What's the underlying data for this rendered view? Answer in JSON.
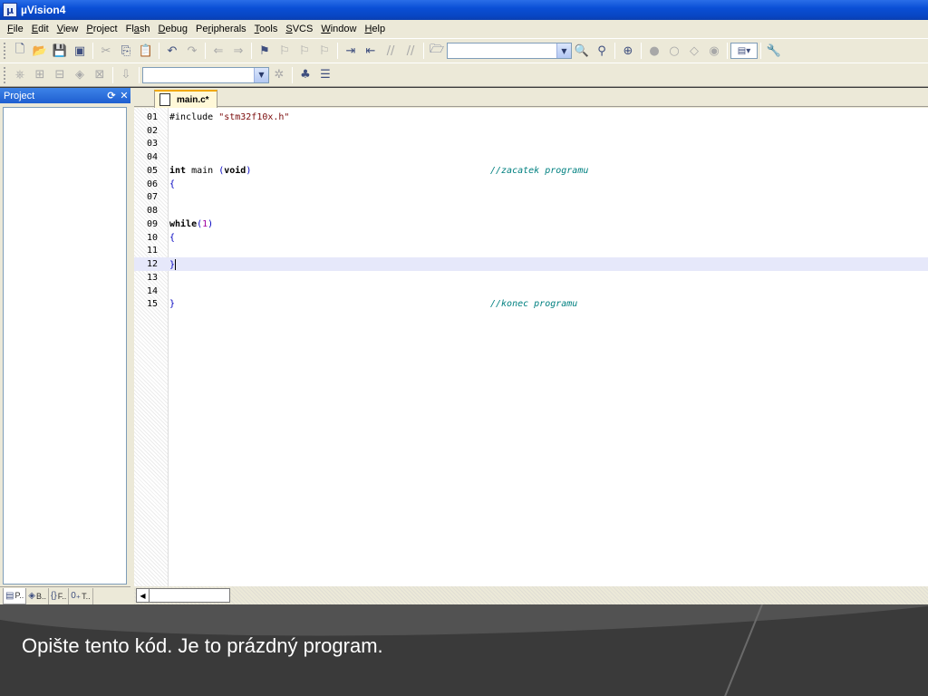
{
  "window": {
    "title": "µVision4"
  },
  "menu": [
    {
      "pre": "",
      "acc": "F",
      "post": "ile"
    },
    {
      "pre": "",
      "acc": "E",
      "post": "dit"
    },
    {
      "pre": "",
      "acc": "V",
      "post": "iew"
    },
    {
      "pre": "",
      "acc": "P",
      "post": "roject"
    },
    {
      "pre": "Fl",
      "acc": "a",
      "post": "sh"
    },
    {
      "pre": "",
      "acc": "D",
      "post": "ebug"
    },
    {
      "pre": "Pe",
      "acc": "r",
      "post": "ipherals"
    },
    {
      "pre": "",
      "acc": "T",
      "post": "ools"
    },
    {
      "pre": "",
      "acc": "S",
      "post": "VCS"
    },
    {
      "pre": "",
      "acc": "W",
      "post": "indow"
    },
    {
      "pre": "",
      "acc": "H",
      "post": "elp"
    }
  ],
  "project_panel": {
    "title": "Project",
    "tabs": [
      {
        "icon": "▤",
        "label": "P..",
        "icon_name": "project-tab-icon"
      },
      {
        "icon": "◈",
        "label": "B..",
        "icon_name": "books-tab-icon"
      },
      {
        "icon": "{}",
        "label": "F..",
        "icon_name": "functions-tab-icon"
      },
      {
        "icon": "0₊",
        "label": "T..",
        "icon_name": "templates-tab-icon"
      }
    ]
  },
  "editor": {
    "active_tab": "main.c*",
    "current_line": 12,
    "lines": [
      {
        "num": "01",
        "html": "#include <span class=\"str\">\"stm32f10x.h\"</span>",
        "comment": ""
      },
      {
        "num": "02",
        "html": "",
        "comment": ""
      },
      {
        "num": "03",
        "html": "",
        "comment": ""
      },
      {
        "num": "04",
        "html": "",
        "comment": ""
      },
      {
        "num": "05",
        "html": "<span class=\"kw\">int</span> main <span class=\"brace\">(</span><span class=\"kw\">void</span><span class=\"brace\">)</span>",
        "comment": "//zacatek programu"
      },
      {
        "num": "06",
        "html": "<span class=\"brace\">{</span>",
        "comment": ""
      },
      {
        "num": "07",
        "html": "",
        "comment": ""
      },
      {
        "num": "08",
        "html": "",
        "comment": ""
      },
      {
        "num": "09",
        "html": "<span class=\"kw\">while</span><span class=\"brace\">(</span><span class=\"num\">1</span><span class=\"brace\">)</span>",
        "comment": ""
      },
      {
        "num": "10",
        "html": "<span class=\"brace\">{</span>",
        "comment": ""
      },
      {
        "num": "11",
        "html": "",
        "comment": ""
      },
      {
        "num": "12",
        "html": "<span class=\"brace\">}</span><span class=\"caret\"></span>",
        "comment": ""
      },
      {
        "num": "13",
        "html": "",
        "comment": ""
      },
      {
        "num": "14",
        "html": "",
        "comment": ""
      },
      {
        "num": "15",
        "html": "<span class=\"brace\">}</span>",
        "comment": "//konec programu"
      }
    ]
  },
  "caption": "Opište tento kód. Je to prázdný program.",
  "colors": {
    "titlebar": "#0a4fd6",
    "chrome": "#ece9d8",
    "comment": "#008080",
    "current_line": "#e6e8fa"
  }
}
